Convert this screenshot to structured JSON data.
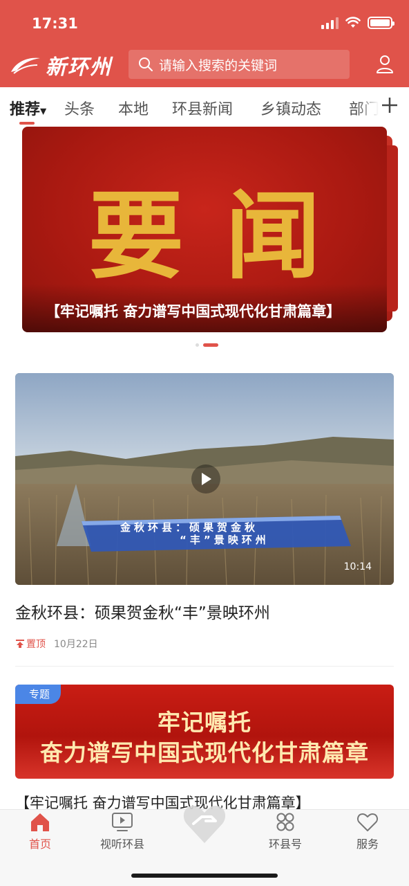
{
  "status_bar": {
    "time": "17:31"
  },
  "header": {
    "app_name": "新环州",
    "search_placeholder": "请输入搜索的关键词"
  },
  "tabs": [
    {
      "label": "推荐",
      "active": true
    },
    {
      "label": "头条"
    },
    {
      "label": "本地"
    },
    {
      "label": "环县新闻"
    },
    {
      "label": "乡镇动态"
    },
    {
      "label": "部门"
    }
  ],
  "banner": {
    "big_text": "要闻",
    "caption": "【牢记嘱托 奋力谱写中国式现代化甘肃篇章】",
    "page_index": 2,
    "page_count": 2
  },
  "video_card": {
    "overlay_line1": "金秋环县：硕果贺金秋",
    "overlay_line2": "“丰”景映环州",
    "duration": "10:14",
    "title": "金秋环县：硕果贺金秋“丰”景映环州",
    "pin_label": "置顶",
    "date": "10月22日"
  },
  "special_card": {
    "tag": "专题",
    "line1": "牢记嘱托",
    "line2": "奋力谱写中国式现代化甘肃篇章",
    "caption": "【牢记嘱托 奋力谱写中国式现代化甘肃篇章】"
  },
  "bottom_nav": [
    {
      "label": "首页",
      "icon": "home-icon",
      "active": true
    },
    {
      "label": "视听环县",
      "icon": "tv-play-icon"
    },
    {
      "label": "",
      "icon": "heart-hand-icon"
    },
    {
      "label": "环县号",
      "icon": "grid-icon"
    },
    {
      "label": "服务",
      "icon": "heart-outline-icon"
    }
  ],
  "colors": {
    "brand": "#e0534a",
    "gold": "#e8b63a",
    "tag_blue": "#4b86e6"
  }
}
